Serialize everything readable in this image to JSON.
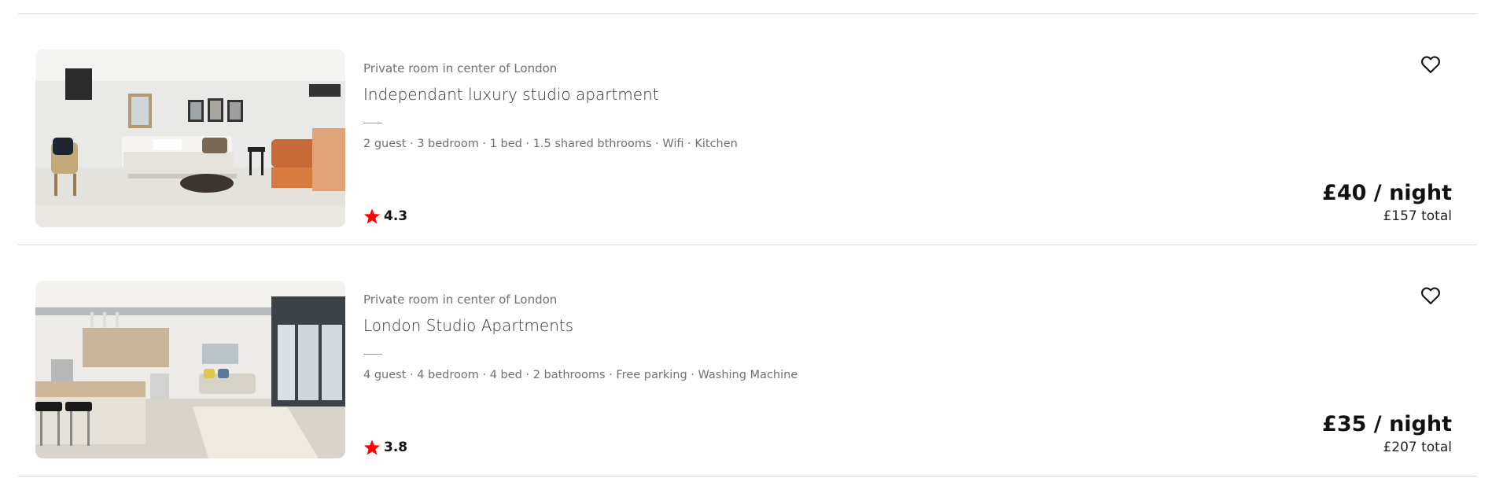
{
  "listings": [
    {
      "subtitle": "Private room in center of London",
      "title": "Independant luxury studio apartment",
      "amenities": "2 guest · 3 bedroom · 1 bed · 1.5 shared bthrooms · Wifi · Kitchen",
      "rating": "4.3",
      "price": "£40 / night",
      "total": "£157 total"
    },
    {
      "subtitle": "Private room in center of London",
      "title": "London Studio Apartments",
      "amenities": "4 guest · 4 bedroom · 4 bed · 2 bathrooms · Free parking · Washing Machine",
      "rating": "3.8",
      "price": "£35 / night",
      "total": "£207 total"
    }
  ],
  "icons": {
    "favorite": "heart-outline-icon",
    "rating": "star-icon"
  },
  "colors": {
    "star": "#ff0000",
    "divider": "#dcdcdc",
    "muted_text": "#717171"
  }
}
